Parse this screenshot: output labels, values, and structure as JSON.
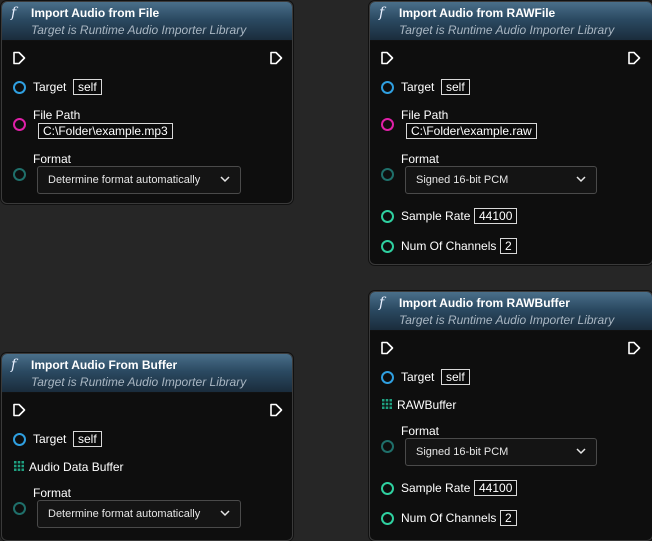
{
  "colors": {
    "background": "#262626",
    "node_body": "#0e0e0e",
    "header_blue": "#2b4a62",
    "object_pin": "#2f9fe0",
    "string_pin": "#e020a8",
    "enum_pin": "#1f6f6a",
    "int_pin": "#2fd0a0"
  },
  "icons": {
    "function": "f",
    "exec_in": "exec-pin-icon",
    "exec_out": "exec-pin-icon",
    "array": "array-grid-icon",
    "dropdown": "chevron-down-icon"
  },
  "nodes": {
    "import_file": {
      "title": "Import Audio from File",
      "subtitle": "Target is Runtime Audio Importer Library",
      "target_label": "Target",
      "target_value": "self",
      "file_path_label": "File Path",
      "file_path_value": "C:\\Folder\\example.mp3",
      "format_label": "Format",
      "format_value": "Determine format automatically"
    },
    "import_rawfile": {
      "title": "Import Audio from RAWFile",
      "subtitle": "Target is Runtime Audio Importer Library",
      "target_label": "Target",
      "target_value": "self",
      "file_path_label": "File Path",
      "file_path_value": "C:\\Folder\\example.raw",
      "format_label": "Format",
      "format_value": "Signed 16-bit PCM",
      "sample_rate_label": "Sample Rate",
      "sample_rate_value": "44100",
      "channels_label": "Num Of Channels",
      "channels_value": "2"
    },
    "import_buffer": {
      "title": "Import Audio From Buffer",
      "subtitle": "Target is Runtime Audio Importer Library",
      "target_label": "Target",
      "target_value": "self",
      "buffer_label": "Audio Data Buffer",
      "format_label": "Format",
      "format_value": "Determine format automatically"
    },
    "import_rawbuffer": {
      "title": "Import Audio from RAWBuffer",
      "subtitle": "Target is Runtime Audio Importer Library",
      "target_label": "Target",
      "target_value": "self",
      "buffer_label": "RAWBuffer",
      "format_label": "Format",
      "format_value": "Signed 16-bit PCM",
      "sample_rate_label": "Sample Rate",
      "sample_rate_value": "44100",
      "channels_label": "Num Of Channels",
      "channels_value": "2"
    }
  }
}
